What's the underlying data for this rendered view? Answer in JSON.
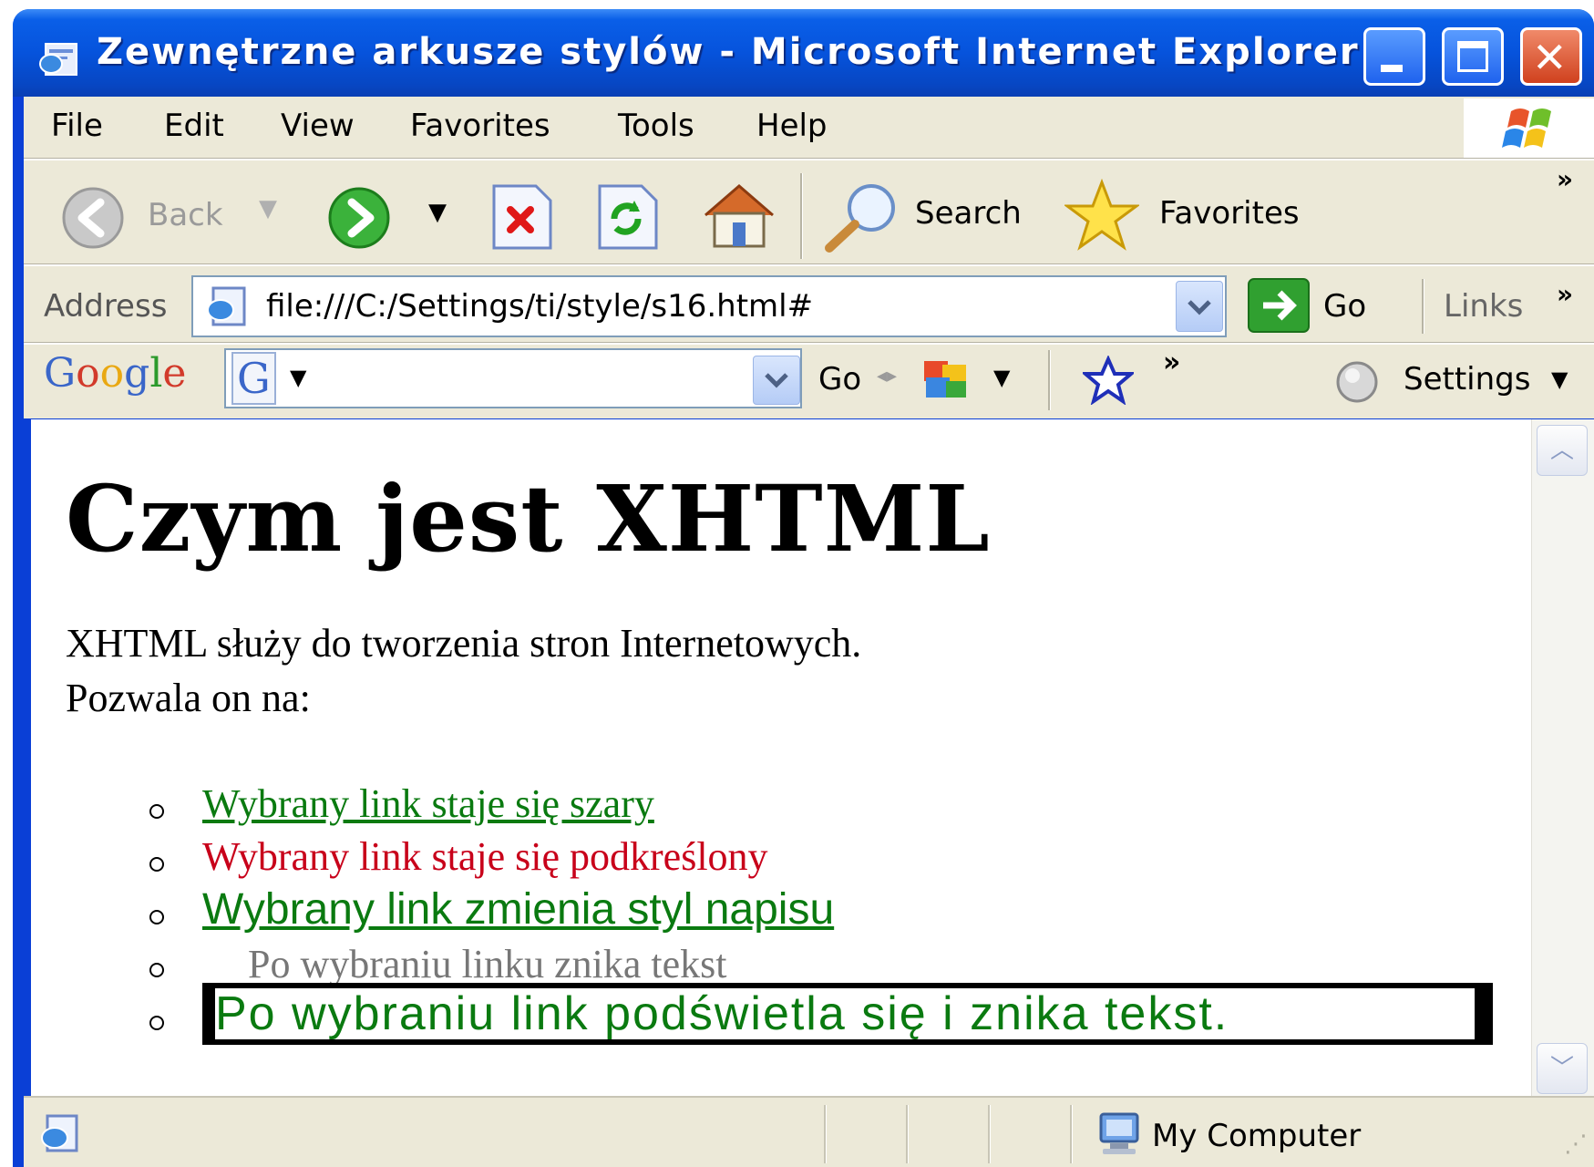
{
  "window": {
    "title": "Zewnętrzne arkusze stylów - Microsoft Internet Explorer"
  },
  "menu": [
    "File",
    "Edit",
    "View",
    "Favorites",
    "Tools",
    "Help"
  ],
  "toolbar": {
    "back_label": "Back",
    "search_label": "Search",
    "favorites_label": "Favorites",
    "more": "»"
  },
  "address_bar": {
    "label": "Address",
    "value": "file:///C:/Settings/ti/style/s16.html#",
    "go_label": "Go",
    "links_label": "Links",
    "more": "»"
  },
  "google_bar": {
    "logo_text": "Google",
    "g_button": "G",
    "go_label": "Go",
    "more": "»",
    "settings_label": "Settings"
  },
  "page": {
    "heading": "Czym jest XHTML",
    "paragraph_line1": "XHTML służy do tworzenia stron Internetowych.",
    "paragraph_line2": "Pozwala on na:",
    "links": [
      "Wybrany link staje się szary",
      "Wybrany link staje się podkreślony",
      "Wybrany link zmienia styl napisu",
      "Po wybraniu linku znika tekst",
      "Po wybraniu link podświetla się i znika tekst."
    ]
  },
  "status_bar": {
    "zone": "My Computer"
  },
  "colors": {
    "titlebar": "#0653dc",
    "link_green": "#0a7a10",
    "link_red": "#c8001a",
    "link_gray": "#777777"
  }
}
